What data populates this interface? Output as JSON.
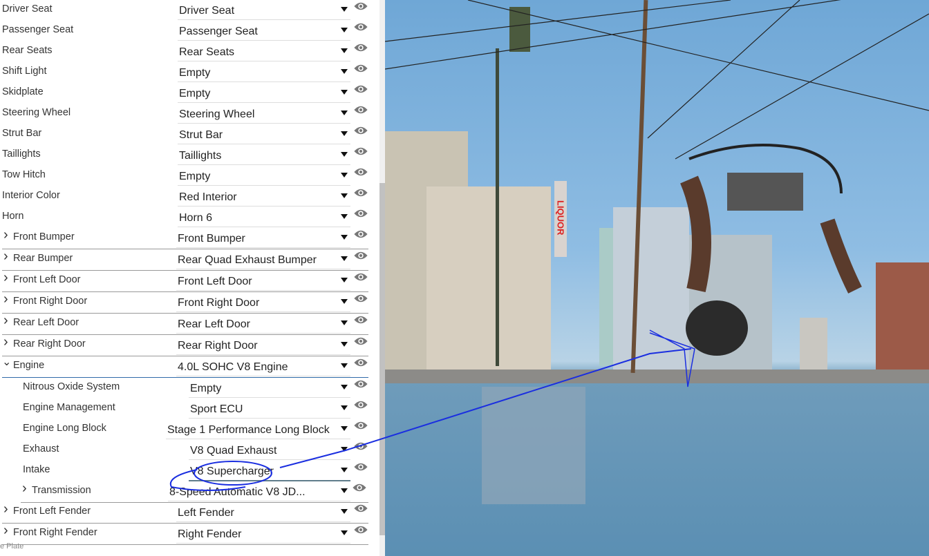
{
  "rows": [
    {
      "type": "top",
      "label": "Driver Seat",
      "value": "Driver Seat"
    },
    {
      "type": "top",
      "label": "Passenger Seat",
      "value": "Passenger Seat"
    },
    {
      "type": "top",
      "label": "Rear Seats",
      "value": "Rear Seats"
    },
    {
      "type": "top",
      "label": "Shift Light",
      "value": "Empty"
    },
    {
      "type": "top",
      "label": "Skidplate",
      "value": "Empty"
    },
    {
      "type": "top",
      "label": "Steering Wheel",
      "value": "Steering Wheel"
    },
    {
      "type": "top",
      "label": "Strut Bar",
      "value": "Strut Bar"
    },
    {
      "type": "top",
      "label": "Taillights",
      "value": "Taillights"
    },
    {
      "type": "top",
      "label": "Tow Hitch",
      "value": "Empty"
    },
    {
      "type": "top",
      "label": "Interior Color",
      "value": "Red Interior"
    },
    {
      "type": "top",
      "label": "Horn",
      "value": "Horn 6"
    },
    {
      "type": "section",
      "label": "Front Bumper",
      "value": "Front Bumper"
    },
    {
      "type": "section",
      "label": "Rear Bumper",
      "value": "Rear Quad Exhaust Bumper"
    },
    {
      "type": "section",
      "label": "Front Left Door",
      "value": "Front Left Door"
    },
    {
      "type": "section",
      "label": "Front Right Door",
      "value": "Front Right Door"
    },
    {
      "type": "section",
      "label": "Rear Left Door",
      "value": "Rear Left Door"
    },
    {
      "type": "section",
      "label": "Rear Right Door",
      "value": "Rear Right Door"
    },
    {
      "type": "section-open",
      "label": "Engine",
      "value": "4.0L SOHC V8 Engine"
    },
    {
      "type": "sub",
      "label": "Nitrous Oxide System",
      "value": "Empty"
    },
    {
      "type": "sub",
      "label": "Engine Management",
      "value": "Sport ECU"
    },
    {
      "type": "sub-wide",
      "label": "Engine Long Block",
      "value": "Stage 1 Performance Long Block"
    },
    {
      "type": "sub",
      "label": "Exhaust",
      "value": "V8 Quad Exhaust"
    },
    {
      "type": "sub-active",
      "label": "Intake",
      "value": "V8 Supercharger"
    },
    {
      "type": "sub-section",
      "label": "Transmission",
      "value": "8-Speed Automatic V8 JD..."
    },
    {
      "type": "section",
      "label": "Front Left Fender",
      "value": "Left Fender"
    },
    {
      "type": "section",
      "label": "Front Right Fender",
      "value": "Right Fender"
    }
  ],
  "footer": "e Plate",
  "colors": {
    "annotation": "#1a2ee0",
    "active_underline": "#607d8b"
  }
}
